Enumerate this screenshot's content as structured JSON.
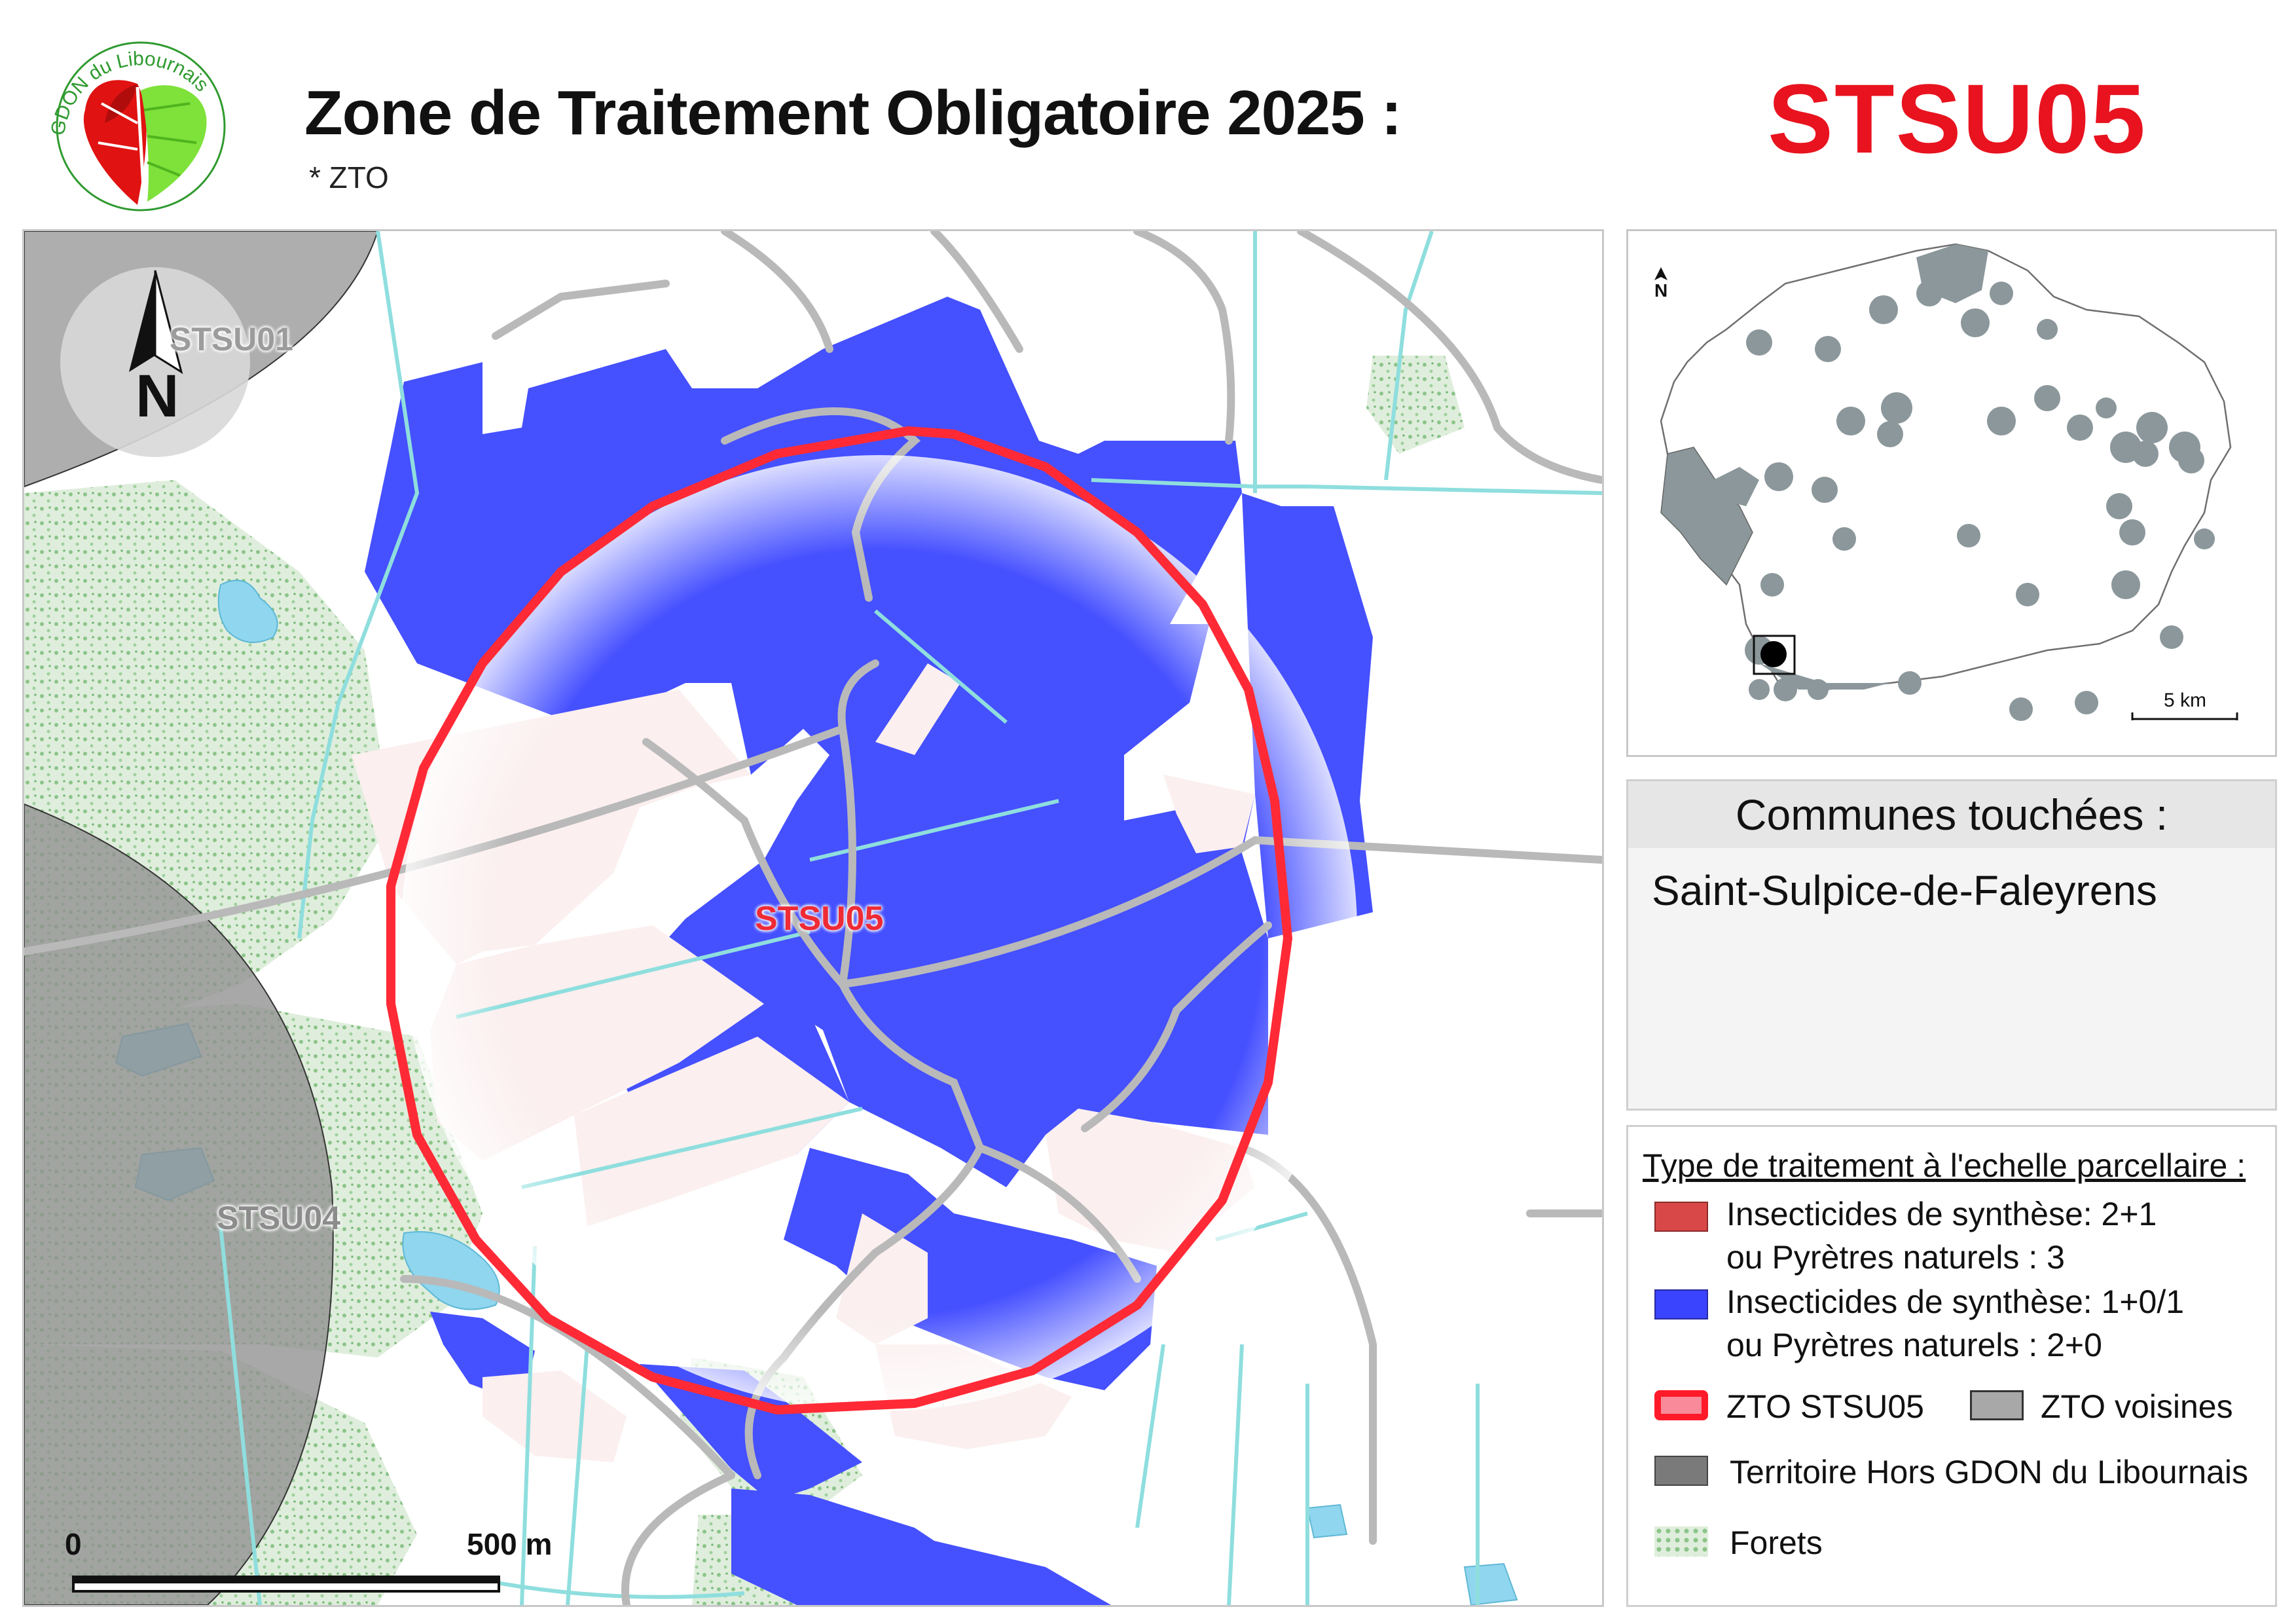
{
  "header": {
    "title": "Zone de Traitement Obligatoire 2025 :",
    "subtitle": "* ZTO",
    "zone_code": "STSU05",
    "logo_text": "GDON du Libournais"
  },
  "main_map": {
    "zone_labels": [
      {
        "label": "STSU05",
        "style": "focus"
      },
      {
        "label": "STSU01",
        "style": "neighbor"
      },
      {
        "label": "STSU04",
        "style": "neighbor"
      }
    ],
    "north_arrow": "N",
    "scale_bar": {
      "start": "0",
      "end": "500 m"
    }
  },
  "inset_map": {
    "north_arrow": "N",
    "scale_bar": "5 km"
  },
  "communes": {
    "heading": "Communes touchées :",
    "items": [
      "Saint-Sulpice-de-Faleyrens"
    ]
  },
  "legend": {
    "title": "Type de traitement à l'echelle parcellaire :",
    "items": [
      {
        "line1": "Insecticides de synthèse: 2+1",
        "line2": "ou Pyrètres naturels : 3",
        "color": "#d94848"
      },
      {
        "line1": "Insecticides de synthèse: 1+0/1",
        "line2": "ou Pyrètres naturels : 2+0",
        "color": "#3a44ff"
      },
      {
        "label": "ZTO STSU05",
        "color": "#ff1a2a"
      },
      {
        "label": "ZTO voisines",
        "color": "#a8a8a8"
      },
      {
        "label": "Territoire Hors GDON du Libournais",
        "color": "#7a7a7a"
      },
      {
        "label": "Forets",
        "color": "#cfe6cf"
      }
    ]
  },
  "colors": {
    "zone_code": "#e8131f",
    "parcel_blue": "#4550ff",
    "zto_ring": "#ff1a2a",
    "zto_neighbor": "#9e9e9e",
    "forest": "#dcebd9",
    "water": "#8fd6ee",
    "road": "#b9b9b9"
  }
}
